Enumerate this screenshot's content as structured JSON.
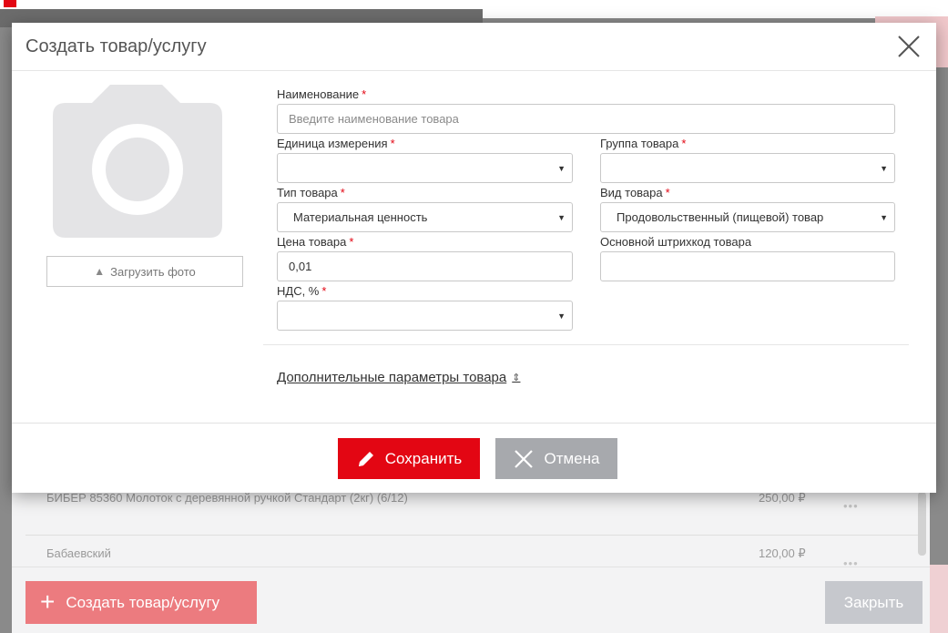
{
  "modal": {
    "title": "Создать товар/услугу",
    "upload_label": "Загрузить фото",
    "fields": {
      "name": {
        "label": "Наименование",
        "required": "*",
        "placeholder": "Введите наименование товара",
        "value": ""
      },
      "unit": {
        "label": "Единица измерения",
        "required": "*",
        "value": ""
      },
      "group": {
        "label": "Группа товара",
        "required": "*",
        "value": ""
      },
      "type": {
        "label": "Тип товара",
        "required": "*",
        "value": "Материальная ценность"
      },
      "kind": {
        "label": "Вид товара",
        "required": "*",
        "value": "Продовольственный (пищевой) товар"
      },
      "price": {
        "label": "Цена товара",
        "required": "*",
        "value": "0,01"
      },
      "barcode": {
        "label": "Основной штрихкод товара",
        "value": ""
      },
      "vat": {
        "label": "НДС, %",
        "required": "*",
        "value": ""
      }
    },
    "more_params": "Дополнительные параметры товара",
    "save_label": "Сохранить",
    "cancel_label": "Отмена"
  },
  "background": {
    "rows": [
      {
        "name": "БИБЕР 85360 Молоток с деревянной ручкой Стандарт (2кг) (6/12)",
        "price": "250,00 ₽"
      },
      {
        "name": "Бабаевский",
        "price": "120,00 ₽"
      }
    ],
    "create_label": "Создать товар/услугу",
    "close_label": "Закрыть"
  },
  "colors": {
    "accent": "#e30613",
    "cancel_gray": "#a7a9ad",
    "create_faded": "#ec7b7f"
  },
  "icons": [
    "close-icon",
    "camera-icon",
    "upload-icon",
    "pencil-icon",
    "cancel-x-icon",
    "plus-icon",
    "more-dots-icon",
    "sort-icon",
    "caret-down-icon"
  ]
}
